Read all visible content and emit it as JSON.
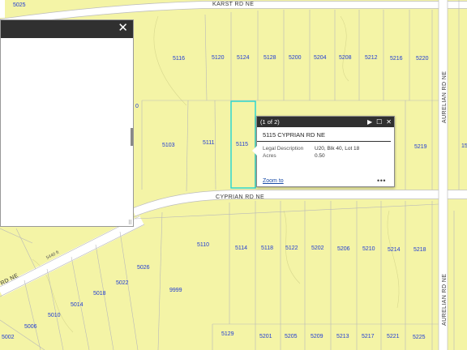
{
  "colors": {
    "parcel_fill": "#f4f4a6",
    "road": "#ffffff",
    "parcel_label": "#1f3bd4",
    "selection": "#22d4d4",
    "panel_header": "#303030"
  },
  "map": {
    "roads": {
      "karst": "KARST RD NE",
      "cyprian": "CYPRIAN RD NE",
      "aurelian_top": "AURELIAN RD NE",
      "aurelian_bottom": "AURELIAN RD NE",
      "diagonal_partial": "RD NE",
      "diagonal_small": "5440 ft"
    },
    "parcels": [
      {
        "label": "5025"
      },
      {
        "label": "5116"
      },
      {
        "label": "5120"
      },
      {
        "label": "5124"
      },
      {
        "label": "5128"
      },
      {
        "label": "5200"
      },
      {
        "label": "5204"
      },
      {
        "label": "5208"
      },
      {
        "label": "5212"
      },
      {
        "label": "5216"
      },
      {
        "label": "5220"
      },
      {
        "label": "0"
      },
      {
        "label": "5103"
      },
      {
        "label": "5111"
      },
      {
        "label": "5115"
      },
      {
        "label": "5219"
      },
      {
        "label": "15"
      },
      {
        "label": "5110"
      },
      {
        "label": "5114"
      },
      {
        "label": "5118"
      },
      {
        "label": "5122"
      },
      {
        "label": "5202"
      },
      {
        "label": "5206"
      },
      {
        "label": "5210"
      },
      {
        "label": "5214"
      },
      {
        "label": "5218"
      },
      {
        "label": "5026"
      },
      {
        "label": "5022"
      },
      {
        "label": "5018"
      },
      {
        "label": "5014"
      },
      {
        "label": "5010"
      },
      {
        "label": "5006"
      },
      {
        "label": "5002"
      },
      {
        "label": "9999"
      },
      {
        "label": "5129"
      },
      {
        "label": "5201"
      },
      {
        "label": "5205"
      },
      {
        "label": "5209"
      },
      {
        "label": "5213"
      },
      {
        "label": "5217"
      },
      {
        "label": "5221"
      },
      {
        "label": "5225"
      }
    ]
  },
  "side_panel": {
    "close_glyph": "✕",
    "resize_glyph": "⠿"
  },
  "popup": {
    "counter": "(1 of 2)",
    "btn_next": "▶",
    "btn_maximize": "☐",
    "btn_close": "✕",
    "title": "5115 CYPRIAN RD NE",
    "fields": [
      {
        "key": "Legal Description",
        "value": "U20, Blk 40, Lot 18"
      },
      {
        "key": "Acres",
        "value": "0.50"
      }
    ],
    "zoom_link": "Zoom to",
    "more_glyph": "•••"
  }
}
